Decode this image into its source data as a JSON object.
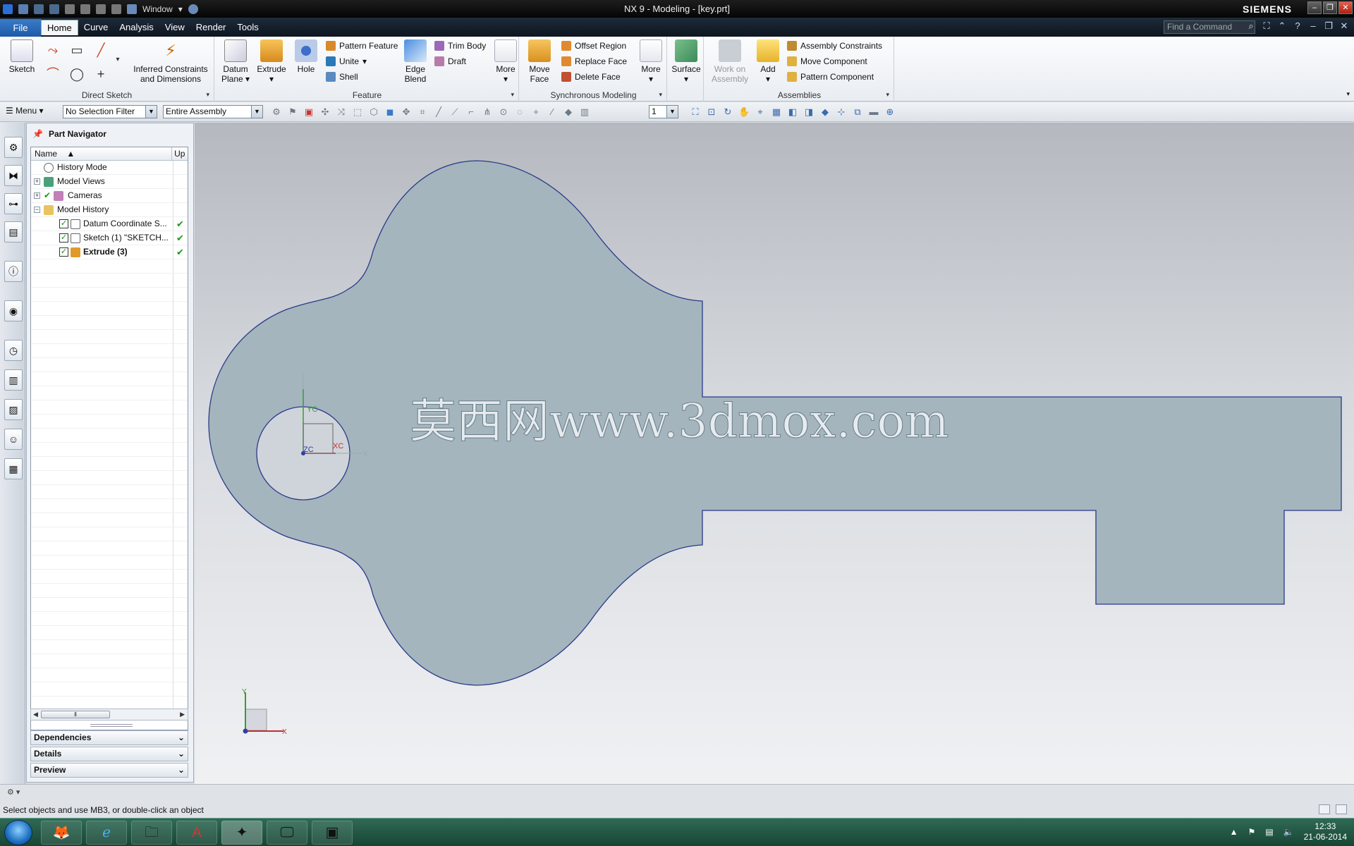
{
  "window": {
    "title": "NX 9 - Modeling - [key.prt]",
    "brand": "SIEMENS",
    "qat_window_label": "Window",
    "window_buttons": [
      "–",
      "❐",
      "✕"
    ]
  },
  "menubar": {
    "file": "File",
    "tabs": [
      "Home",
      "Curve",
      "Analysis",
      "View",
      "Render",
      "Tools"
    ],
    "active_tab": "Home",
    "find_command_placeholder": "Find a Command"
  },
  "ribbon": {
    "direct_sketch": {
      "label": "Direct Sketch",
      "sketch": "Sketch",
      "inferred": "Inferred Constraints and Dimensions"
    },
    "feature": {
      "label": "Feature",
      "datum_plane": "Datum Plane",
      "extrude": "Extrude",
      "hole": "Hole",
      "pattern_feature": "Pattern Feature",
      "unite": "Unite",
      "shell": "Shell",
      "edge_blend": "Edge Blend",
      "trim_body": "Trim Body",
      "draft": "Draft",
      "more": "More"
    },
    "sync": {
      "label": "Synchronous Modeling",
      "move_face": "Move Face",
      "offset_region": "Offset Region",
      "replace_face": "Replace Face",
      "delete_face": "Delete Face",
      "more": "More"
    },
    "surface": {
      "label": "Surface"
    },
    "assemblies": {
      "label": "Assemblies",
      "work_on_assembly": "Work on Assembly",
      "add": "Add",
      "assembly_constraints": "Assembly Constraints",
      "move_component": "Move Component",
      "pattern_component": "Pattern Component"
    }
  },
  "toolbar2": {
    "menu": "Menu",
    "selection_filter": "No Selection Filter",
    "scope": "Entire Assembly",
    "layer_value": "1"
  },
  "navigator": {
    "title": "Part Navigator",
    "col_name": "Name",
    "col_up": "Up",
    "rows": [
      {
        "label": "History Mode"
      },
      {
        "label": "Model Views"
      },
      {
        "label": "Cameras"
      },
      {
        "label": "Model History"
      },
      {
        "label": "Datum Coordinate S..."
      },
      {
        "label": "Sketch (1) \"SKETCH..."
      },
      {
        "label": "Extrude (3)"
      }
    ],
    "panels": [
      "Dependencies",
      "Details",
      "Preview"
    ]
  },
  "graphics": {
    "watermark": "莫西网www.3dmox.com",
    "wcs_labels": {
      "yc": "YC",
      "xc": "XC",
      "zc": "ZC",
      "x": "X"
    },
    "triad_labels": {
      "y": "Y",
      "x": "X"
    },
    "part_fill": "#a4b5bd",
    "part_edge": "#2a3a8a"
  },
  "status": {
    "prompt": "Select objects and use MB3, or double-click an object"
  },
  "taskbar": {
    "time": "12:33",
    "date": "21-06-2014"
  }
}
